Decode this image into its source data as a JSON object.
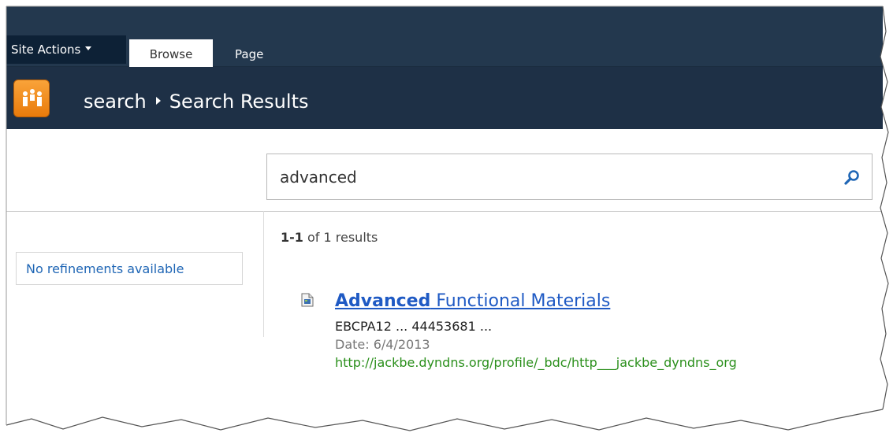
{
  "ribbon": {
    "site_actions_label": "Site Actions",
    "tabs": [
      {
        "label": "Browse",
        "selected": true
      },
      {
        "label": "Page",
        "selected": false
      }
    ]
  },
  "title_bar": {
    "breadcrumb": [
      "search",
      "Search Results"
    ]
  },
  "search": {
    "query": "advanced"
  },
  "refinement": {
    "message": "No refinements available"
  },
  "results": {
    "range": "1-1",
    "summary": "of 1 results",
    "items": [
      {
        "title_highlight": "Advanced",
        "title_rest": " Functional Materials",
        "snippet": "EBCPA12 ... 44453681 ...",
        "date": "Date: 6/4/2013",
        "url": "http://jackbe.dyndns.org/profile/_bdc/http___jackbe_dyndns_org"
      }
    ]
  },
  "colors": {
    "ribbon_bg": "#23384e",
    "title_bar_bg": "#1e3046",
    "link_blue": "#1f5ac4",
    "url_green": "#2a8f1b",
    "logo_orange": "#f08c1e"
  }
}
